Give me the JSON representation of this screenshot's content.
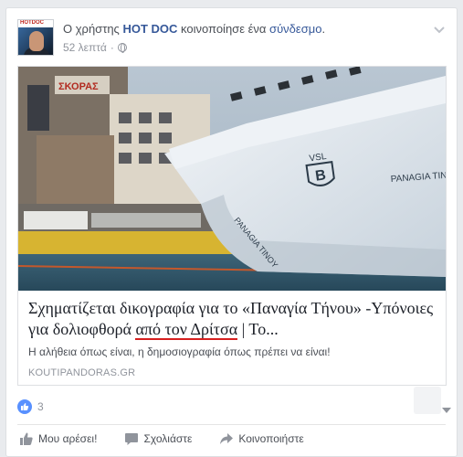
{
  "post": {
    "author_prefix": "Ο χρήστης",
    "author": "HOT DOC",
    "action_text": "κοινοποίησε ένα",
    "action_link": "σύνδεσμο",
    "action_suffix": ".",
    "avatar_logo_text": "HOTDOC",
    "timestamp": "52 λεπτά",
    "meta_separator": "·",
    "privacy_icon": "globe-icon"
  },
  "link": {
    "title_part1": "Σχηματίζεται δικογραφία για το «Παναγία Τήνου» -Υπόνοιες για δολιοφθορά ",
    "title_underlined": "από τον Δρίτσα",
    "title_part2": " | Το...",
    "description": "Η αλήθεια όπως είναι, η δημοσιογραφία όπως πρέπει να είναι!",
    "domain": "KOUTIPANDORAS.GR",
    "image_ship_name": "PANAGIA TINO",
    "image_logo_text": "VSL",
    "image_sign_text": "ΣΚΟΡΑΣ"
  },
  "reactions": {
    "count": "3",
    "icon": "like-icon"
  },
  "actions": {
    "like": "Μου αρέσει!",
    "comment": "Σχολιάστε",
    "share": "Κοινοποιήστε"
  },
  "colors": {
    "link_blue": "#365899",
    "meta_gray": "#90949c",
    "like_blue": "#5890ff",
    "underline_red": "#d61f1f"
  }
}
